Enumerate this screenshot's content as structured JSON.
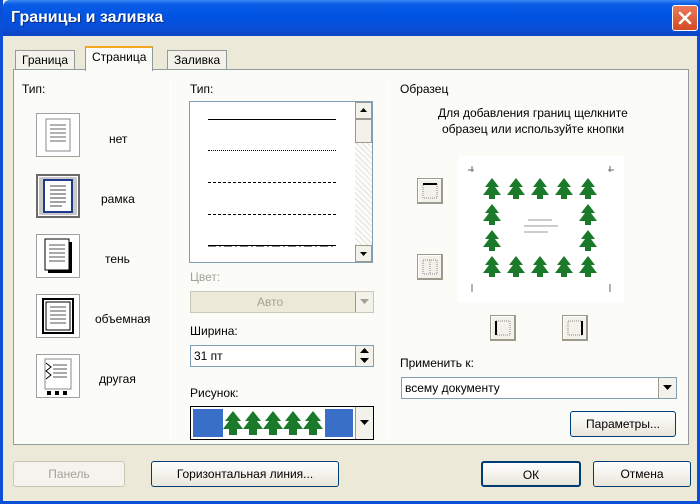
{
  "window": {
    "title": "Границы и заливка"
  },
  "tabs": [
    {
      "label": "Граница"
    },
    {
      "label": "Страница"
    },
    {
      "label": "Заливка"
    }
  ],
  "type_section": {
    "label": "Тип:",
    "presets": [
      {
        "label": "нет"
      },
      {
        "label": "рамка"
      },
      {
        "label": "тень"
      },
      {
        "label": "объемная"
      },
      {
        "label": "другая"
      }
    ]
  },
  "style_section": {
    "label": "Тип:",
    "line_styles": [
      "solid",
      "dotted",
      "dashed-fine",
      "dashed",
      "dash-dot"
    ],
    "color_label": "Цвет:",
    "color_value": "Авто",
    "width_label": "Ширина:",
    "width_value": "31 пт",
    "art_label": "Рисунок:"
  },
  "preview": {
    "label": "Образец",
    "hint_line1": "Для добавления границ щелкните",
    "hint_line2": "образец или используйте кнопки",
    "apply_label": "Применить к:",
    "apply_value": "всему документу",
    "options_button": "Параметры..."
  },
  "footer": {
    "toolbar_button": "Панель",
    "hline_button": "Горизонтальная линия...",
    "ok_button": "ОК",
    "cancel_button": "Отмена"
  },
  "colors": {
    "title_blue": "#0054e3",
    "tree_green": "#1a7a2a",
    "art_bg": "#3a6fc8"
  }
}
